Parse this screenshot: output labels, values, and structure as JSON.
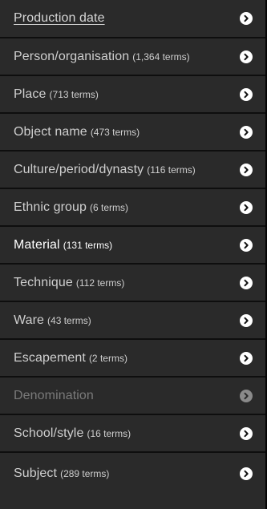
{
  "facets": [
    {
      "label": "Production date",
      "count": ""
    },
    {
      "label": "Person/organisation",
      "count": "(1,364 terms)"
    },
    {
      "label": "Place",
      "count": "(713 terms)"
    },
    {
      "label": "Object name",
      "count": "(473 terms)"
    },
    {
      "label": "Culture/period/dynasty",
      "count": "(116 terms)"
    },
    {
      "label": "Ethnic group",
      "count": "(6 terms)"
    },
    {
      "label": "Material",
      "count": "(131 terms)"
    },
    {
      "label": "Technique",
      "count": "(112 terms)"
    },
    {
      "label": "Ware",
      "count": "(43 terms)"
    },
    {
      "label": "Escapement",
      "count": "(2 terms)"
    },
    {
      "label": "Denomination",
      "count": ""
    },
    {
      "label": "School/style",
      "count": "(16 terms)"
    },
    {
      "label": "Subject",
      "count": "(289 terms)"
    }
  ],
  "icons": {
    "arrow": "chevron-right-icon"
  },
  "colors": {
    "background": "#2a2a2a",
    "divider": "#0e0e0e",
    "text": "#cfcfcf",
    "active_text": "#ffffff",
    "disabled_text": "#7a7a7a",
    "arrow_bg": "#ffffff"
  }
}
